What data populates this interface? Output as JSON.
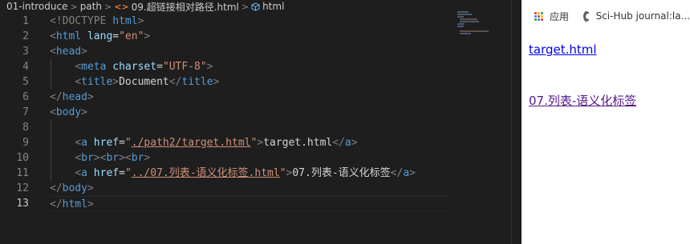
{
  "editor": {
    "breadcrumb": {
      "folder1": "01-introduce",
      "folder2": "path",
      "file": "09.超链接相对路径.html",
      "symbol": "html",
      "file_icon": "<>"
    },
    "line_numbers": [
      "1",
      "2",
      "3",
      "4",
      "5",
      "6",
      "7",
      "8",
      "9",
      "10",
      "11",
      "12",
      "13"
    ],
    "code": {
      "l1_doctype": "<!DOCTYPE",
      "l1_html": " html",
      "l1_close": ">",
      "l2_open": "<",
      "l2_tag": "html",
      "l2_attr": " lang",
      "l2_eq": "=",
      "l2_val": "\"en\"",
      "l2_close": ">",
      "l3_open": "<",
      "l3_tag": "head",
      "l3_close": ">",
      "l4_open": "<",
      "l4_tag": "meta",
      "l4_attr": " charset",
      "l4_eq": "=",
      "l4_val": "\"UTF-8\"",
      "l4_close": ">",
      "l5_open": "<",
      "l5_tag": "title",
      "l5_mid": ">",
      "l5_text": "Document",
      "l5_end_open": "</",
      "l5_end_tag": "title",
      "l5_close": ">",
      "l6_open": "</",
      "l6_tag": "head",
      "l6_close": ">",
      "l7_open": "<",
      "l7_tag": "body",
      "l7_close": ">",
      "l9_open": "<",
      "l9_tag": "a",
      "l9_attr": " href",
      "l9_eq": "=",
      "l9_q1": "\"",
      "l9_path": "./path2/target.html",
      "l9_q2": "\"",
      "l9_mid": ">",
      "l9_text": "target.html",
      "l9_end_open": "</",
      "l9_end_tag": "a",
      "l9_close": ">",
      "l10_o1": "<",
      "l10_t1": "br",
      "l10_c1": "><",
      "l10_t2": "br",
      "l10_c2": "><",
      "l10_t3": "br",
      "l10_c3": ">",
      "l11_open": "<",
      "l11_tag": "a",
      "l11_attr": " href",
      "l11_eq": "=",
      "l11_q1": "\"",
      "l11_path": "../07.列表-语义化标签.html",
      "l11_q2": "\"",
      "l11_mid": ">",
      "l11_text": "07.列表-语义化标签",
      "l11_end_open": "</",
      "l11_end_tag": "a",
      "l11_close": ">",
      "l12_open": "</",
      "l12_tag": "body",
      "l12_close": ">",
      "l13_open": "</",
      "l13_tag": "html",
      "l13_close": ">"
    }
  },
  "browser": {
    "bookmarks": [
      {
        "icon": "apps-grid-icon",
        "label": "应用"
      },
      {
        "icon": "globe-icon",
        "label": "Sci-Hub journal:la..."
      }
    ],
    "links": [
      {
        "text": "target.html",
        "state": "unvisited"
      },
      {
        "text": "07.列表-语义化标签",
        "state": "visited"
      }
    ],
    "colors": {
      "link": "#0000ee",
      "visited_link": "#551a8b",
      "editor_bg": "#1e1e1e",
      "tag": "#569cd6",
      "attr": "#9cdcfe",
      "string": "#ce9178"
    }
  }
}
